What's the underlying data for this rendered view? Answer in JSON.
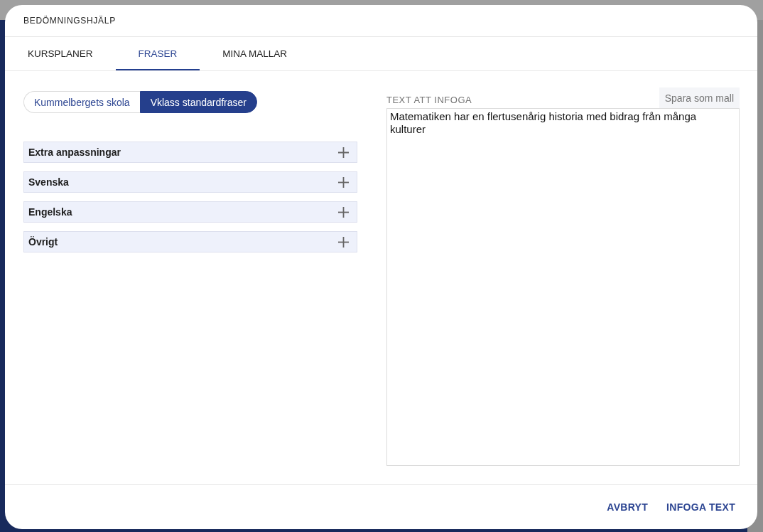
{
  "dialog": {
    "title": "BEDÖMNINGSHJÄLP"
  },
  "tabs": [
    {
      "label": "KURSPLANER",
      "selected": false
    },
    {
      "label": "FRASER",
      "selected": true
    },
    {
      "label": "MINA MALLAR",
      "selected": false
    }
  ],
  "source_toggle": [
    {
      "label": "Kummelbergets skola",
      "selected": false
    },
    {
      "label": "Vklass standardfraser",
      "selected": true
    }
  ],
  "categories": [
    {
      "label": "Extra anpassningar",
      "expanded": false
    },
    {
      "label": "Svenska",
      "expanded": false
    },
    {
      "label": "Engelska",
      "expanded": false
    },
    {
      "label": "Övrigt",
      "expanded": false
    }
  ],
  "text_to_insert": {
    "label": "TEXT ATT INFOGA",
    "save_button": "Spara som mall",
    "value": "Matematiken har en flertusenårig historia med bidrag från många kulturer"
  },
  "footer_buttons": [
    "AVBRYT",
    "INFOGA TEXT"
  ]
}
